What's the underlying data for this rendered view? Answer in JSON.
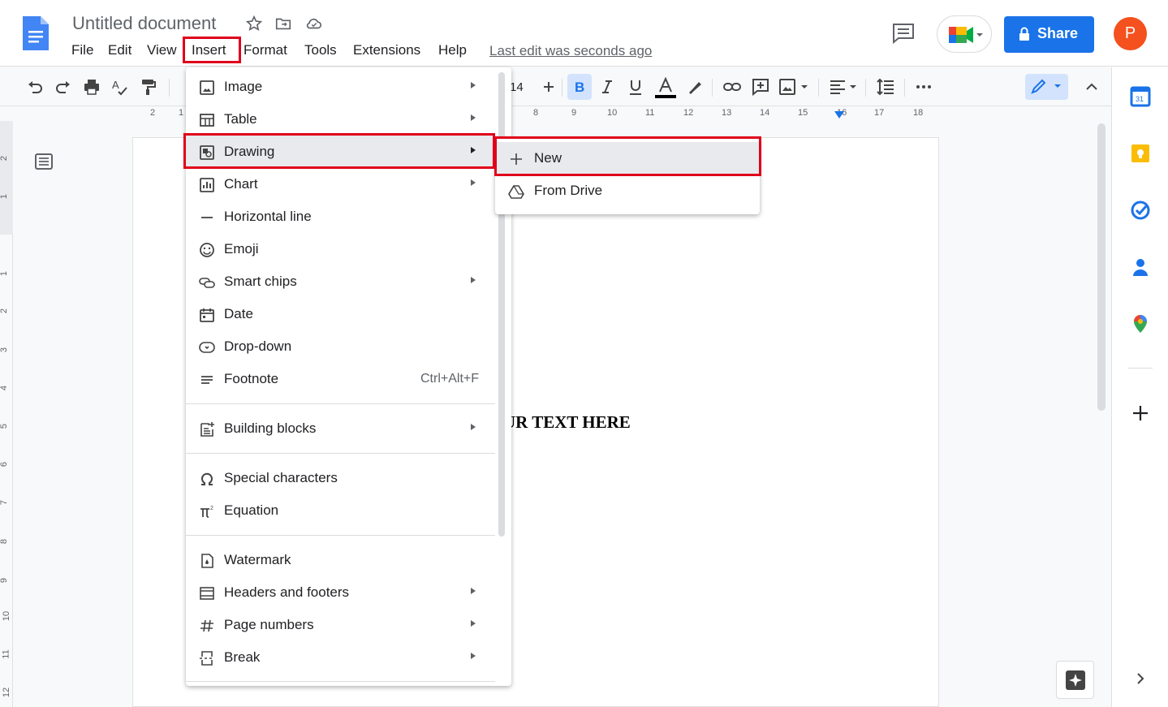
{
  "document": {
    "title": "Untitled document",
    "last_edit": "Last edit was seconds ago",
    "body_text": "UR TEXT HERE"
  },
  "menubar": [
    "File",
    "Edit",
    "View",
    "Insert",
    "Format",
    "Tools",
    "Extensions",
    "Help"
  ],
  "header": {
    "share_label": "Share",
    "avatar_letter": "P"
  },
  "toolbar": {
    "font_size": "14"
  },
  "ruler": {
    "horizontal": [
      "2",
      "1",
      "8",
      "9",
      "10",
      "11",
      "12",
      "13",
      "14",
      "15",
      "16",
      "17",
      "18"
    ],
    "vertical": [
      "2",
      "1",
      "1",
      "2",
      "3",
      "4",
      "5",
      "6",
      "7",
      "8",
      "9",
      "10",
      "11",
      "12"
    ]
  },
  "insert_menu": {
    "items": [
      {
        "label": "Image",
        "icon": "image-icon",
        "submenu": true
      },
      {
        "label": "Table",
        "icon": "table-icon",
        "submenu": true
      },
      {
        "label": "Drawing",
        "icon": "drawing-icon",
        "submenu": true,
        "highlighted": true
      },
      {
        "label": "Chart",
        "icon": "chart-icon",
        "submenu": true
      },
      {
        "label": "Horizontal line",
        "icon": "horizontal-line-icon",
        "submenu": false
      },
      {
        "label": "Emoji",
        "icon": "emoji-icon",
        "submenu": false
      },
      {
        "label": "Smart chips",
        "icon": "smart-chips-icon",
        "submenu": true
      },
      {
        "label": "Date",
        "icon": "date-icon",
        "submenu": false
      },
      {
        "label": "Drop-down",
        "icon": "dropdown-icon",
        "submenu": false
      },
      {
        "label": "Footnote",
        "icon": "footnote-icon",
        "submenu": false,
        "shortcut": "Ctrl+Alt+F"
      },
      {
        "label": "Building blocks",
        "icon": "building-blocks-icon",
        "submenu": true
      },
      {
        "label": "Special characters",
        "icon": "omega-icon",
        "submenu": false
      },
      {
        "label": "Equation",
        "icon": "pi-icon",
        "submenu": false
      },
      {
        "label": "Watermark",
        "icon": "watermark-icon",
        "submenu": false
      },
      {
        "label": "Headers and footers",
        "icon": "header-footer-icon",
        "submenu": true
      },
      {
        "label": "Page numbers",
        "icon": "hash-icon",
        "submenu": true
      },
      {
        "label": "Break",
        "icon": "break-icon",
        "submenu": true
      }
    ]
  },
  "drawing_submenu": {
    "items": [
      {
        "label": "New",
        "icon": "plus-icon",
        "highlighted": true
      },
      {
        "label": "From Drive",
        "icon": "drive-icon"
      }
    ]
  },
  "colors": {
    "accent": "#1a73e8",
    "highlight_box": "#e0001b",
    "avatar": "#f4511e"
  }
}
